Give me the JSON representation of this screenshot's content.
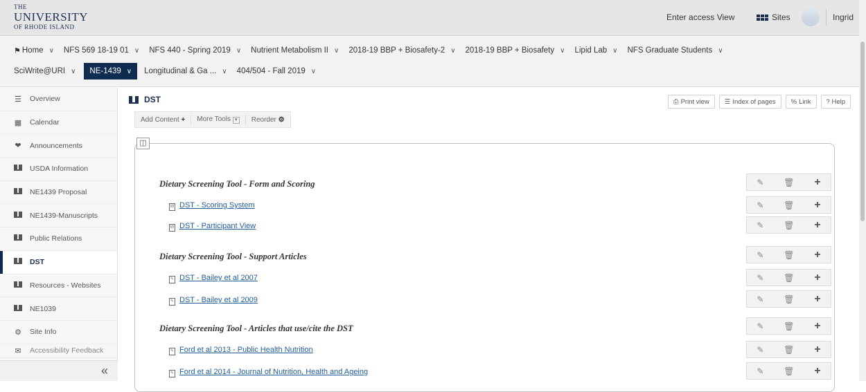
{
  "header": {
    "logo": {
      "line1": "THE",
      "line2": "UNIVERSITY",
      "line3": "OF RHODE ISLAND"
    },
    "access_view_label": "Enter access View",
    "sites_label": "Sites",
    "user_name": "Ingrid"
  },
  "site_tabs": {
    "row1": [
      "Home",
      "NFS 569 18-19 01",
      "NFS 440 - Spring 2019",
      "Nutrient Metabolism II",
      "2018-19 BBP + Biosafety-2",
      "2018-19 BBP + Biosafety",
      "Lipid Lab",
      "NFS Graduate Students"
    ],
    "row2": [
      "SciWrite@URI",
      "NE-1439",
      "Longitudinal & Ga ...",
      "404/504 - Fall 2019"
    ],
    "active": "NE-1439"
  },
  "sidebar": {
    "items": [
      {
        "label": "Overview",
        "icon": "list-icon"
      },
      {
        "label": "Calendar",
        "icon": "calendar-icon"
      },
      {
        "label": "Announcements",
        "icon": "megaphone-icon"
      },
      {
        "label": "USDA Information",
        "icon": "book-icon"
      },
      {
        "label": "NE1439 Proposal",
        "icon": "book-icon"
      },
      {
        "label": "NE1439-Manuscripts",
        "icon": "book-icon"
      },
      {
        "label": "Public Relations",
        "icon": "book-icon"
      },
      {
        "label": "DST",
        "icon": "book-icon"
      },
      {
        "label": "Resources - Websites",
        "icon": "book-icon"
      },
      {
        "label": "NE1039",
        "icon": "book-icon"
      },
      {
        "label": "Site Info",
        "icon": "gear-icon"
      },
      {
        "label": "Accessibility Feedback",
        "icon": "feedback-icon"
      }
    ],
    "active": "DST",
    "collapse_glyph": "«"
  },
  "main": {
    "title": "DST",
    "toolbar": {
      "add_content": "Add Content",
      "more_tools": "More Tools",
      "reorder": "Reorder"
    },
    "right_tools": {
      "print": "Print view",
      "index": "Index of pages",
      "link": "Link",
      "help": "? Help"
    },
    "items": [
      {
        "type": "heading",
        "text": "Dietary Screening Tool - Form and Scoring"
      },
      {
        "type": "link",
        "text": "DST - Scoring System",
        "icon": "word-doc-icon"
      },
      {
        "type": "link",
        "text": "DST - Participant View",
        "icon": "word-doc-icon"
      },
      {
        "type": "heading",
        "text": "Dietary Screening Tool - Support Articles"
      },
      {
        "type": "link",
        "text": "DST - Bailey et al 2007",
        "icon": "pdf-icon"
      },
      {
        "type": "link",
        "text": "DST - Bailey et al 2009",
        "icon": "pdf-icon"
      },
      {
        "type": "heading",
        "text": "Dietary Screening Tool - Articles that use/cite the DST"
      },
      {
        "type": "link",
        "text": "Ford et al 2013 - Public Health Nutrition",
        "icon": "pdf-icon"
      },
      {
        "type": "link",
        "text": "Ford et al 2014 - Journal of Nutrition, Health and Ageing",
        "icon": "pdf-icon"
      }
    ]
  }
}
